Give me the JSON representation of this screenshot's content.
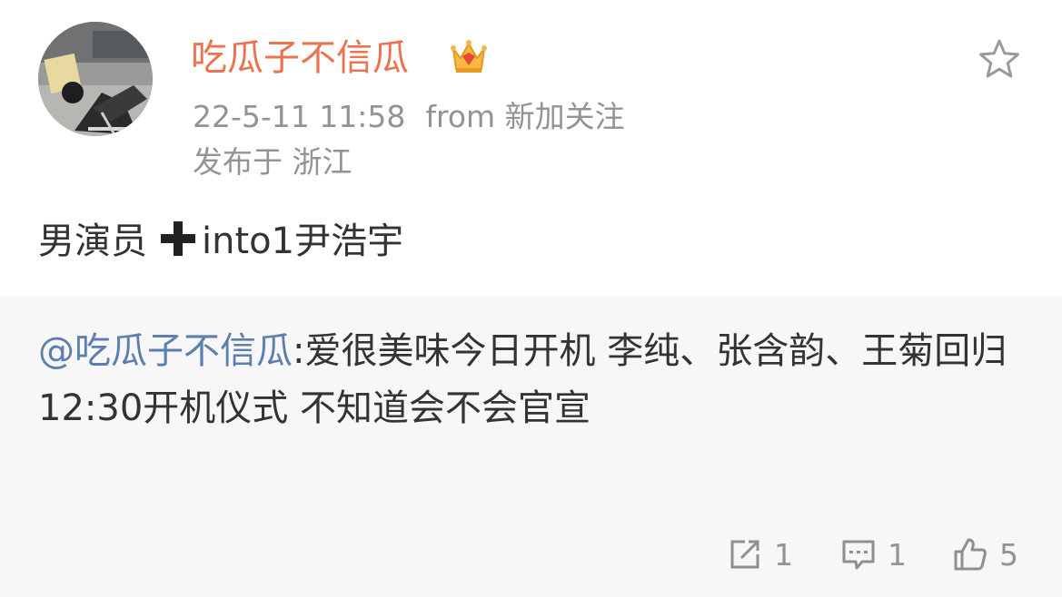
{
  "post": {
    "author": "吃瓜子不信瓜",
    "time": "22-5-11 11:58",
    "source": "from 新加关注",
    "location": "发布于 浙江",
    "text_before": "男演员",
    "text_after": "into1尹浩宇"
  },
  "repost": {
    "mention": "@吃瓜子不信瓜",
    "line1_rest": ":爱很美味今日开机 李纯、张含韵、王菊回归",
    "line2": "12:30开机仪式 不知道会不会官宣"
  },
  "actions": {
    "repost_count": "1",
    "comment_count": "1",
    "like_count": "5"
  },
  "icons": {
    "avatar": "user-avatar-photo",
    "badge": "crown-icon",
    "favorite": "star-icon",
    "plus": "heavy-plus-icon",
    "repost": "repost-icon",
    "comment": "comment-icon",
    "like": "thumbs-up-icon"
  },
  "colors": {
    "username": "#eb7350",
    "meta": "#939393",
    "mention": "#5b7fae",
    "repost_bg": "#f7f7f7"
  }
}
